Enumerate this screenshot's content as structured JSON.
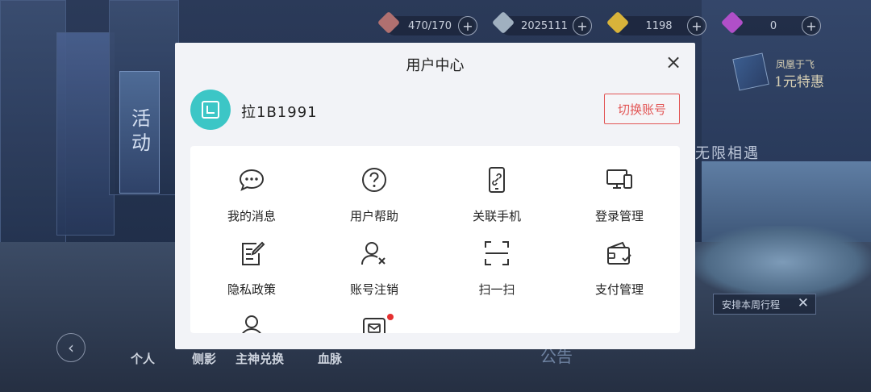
{
  "resources": [
    {
      "value": "470/170",
      "icon": "heart-icon",
      "color": "#b07070"
    },
    {
      "value": "2025111",
      "icon": "coin-icon",
      "color": "#a0b0c0"
    },
    {
      "value": "1198",
      "icon": "crystal-icon",
      "color": "#d8b33a"
    },
    {
      "value": "0",
      "icon": "gem-icon",
      "color": "#b04fc8"
    }
  ],
  "background": {
    "activity_banner": "活动",
    "promo_line1": "凤凰于飞",
    "promo_line2": "1元特惠",
    "infinite_text": "无限相遇",
    "schedule_label": "安排本周行程",
    "nav_items": [
      "个人",
      "侧影",
      "主神兑换",
      "血脉"
    ],
    "notice_text": "公告"
  },
  "dialog": {
    "title": "用户中心",
    "user": {
      "name": "拉1B1991"
    },
    "switch_account_label": "切换账号",
    "menu": [
      {
        "label": "我的消息",
        "icon": "message-icon"
      },
      {
        "label": "用户帮助",
        "icon": "help-icon"
      },
      {
        "label": "关联手机",
        "icon": "phone-link-icon"
      },
      {
        "label": "登录管理",
        "icon": "devices-icon"
      },
      {
        "label": "隐私政策",
        "icon": "privacy-doc-icon"
      },
      {
        "label": "账号注销",
        "icon": "account-delete-icon"
      },
      {
        "label": "扫一扫",
        "icon": "scan-icon"
      },
      {
        "label": "支付管理",
        "icon": "wallet-icon"
      },
      {
        "label": "",
        "icon": "user-icon"
      },
      {
        "label": "",
        "icon": "mailbox-icon",
        "badge": true
      }
    ]
  },
  "colors": {
    "accent": "#e25555",
    "avatar_bg": "#3cc6c6"
  }
}
